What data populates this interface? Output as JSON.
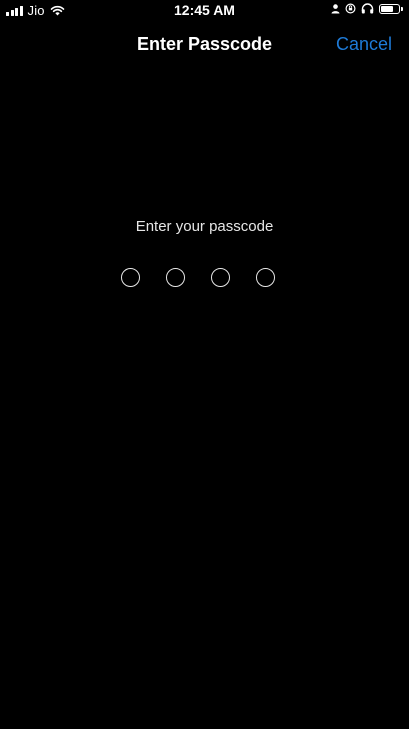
{
  "status_bar": {
    "carrier": "Jio",
    "time": "12:45 AM",
    "battery_level": 0.7,
    "icons": [
      "signal-icon",
      "wifi-icon",
      "person-icon",
      "lock-rotation-icon",
      "headphones-icon",
      "battery-icon"
    ]
  },
  "nav": {
    "title": "Enter Passcode",
    "cancel_label": "Cancel"
  },
  "passcode": {
    "prompt": "Enter your passcode",
    "digits_total": 4,
    "digits_entered": 0
  },
  "colors": {
    "background": "#000000",
    "text": "#ffffff",
    "accent": "#1e7bd8"
  }
}
